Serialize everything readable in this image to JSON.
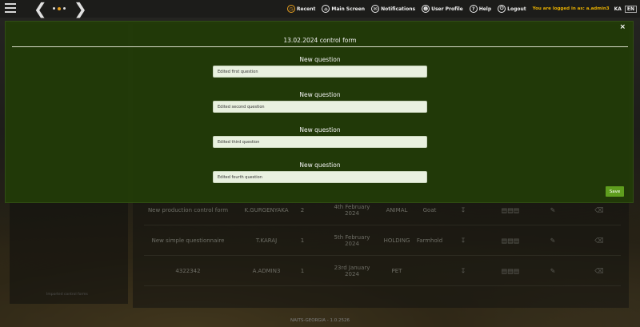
{
  "topbar": {
    "menu": [
      {
        "label": "Recent",
        "icon": "recent-icon"
      },
      {
        "label": "Main Screen",
        "icon": "home-icon"
      },
      {
        "label": "Notifications",
        "icon": "bell-icon"
      },
      {
        "label": "User Profile",
        "icon": "user-icon"
      },
      {
        "label": "Help",
        "icon": "help-icon"
      },
      {
        "label": "Logout",
        "icon": "power-icon"
      }
    ],
    "logged_in_text": "You are logged in as: a.admin3",
    "languages": [
      "KA",
      "EN"
    ],
    "selected_language": "EN"
  },
  "background_table": {
    "rows": [
      {
        "name": "New production control form",
        "user": "K.GURGENYAKA",
        "num": "2",
        "date": "4th February 2024",
        "type": "ANIMAL",
        "sub": "Goat"
      },
      {
        "name": "New simple questionnaire",
        "user": "T.KARAJ",
        "num": "1",
        "date": "5th February 2024",
        "type": "HOLDING",
        "sub": "Farmhold"
      },
      {
        "name": "4322342",
        "user": "A.ADMIN3",
        "num": "1",
        "date": "23rd January 2024",
        "type": "PET",
        "sub": ""
      }
    ]
  },
  "side_footer": "Imported control forms",
  "footer": "NAITS-GEORGIA - 1.0.2526",
  "modal": {
    "title": "13.02.2024 control form",
    "questions": [
      {
        "label": "New question",
        "value": "Edited first question"
      },
      {
        "label": "New question",
        "value": "Edited second question"
      },
      {
        "label": "New question",
        "value": "Edited third question"
      },
      {
        "label": "New question",
        "value": "Edited fourth question"
      }
    ],
    "save_label": "Save",
    "close_glyph": "×"
  },
  "colors": {
    "modal_bg": "#223c08",
    "save_button": "#5f9e1e",
    "logged_in_text": "#e8b000",
    "recent_icon": "#e8a020"
  }
}
